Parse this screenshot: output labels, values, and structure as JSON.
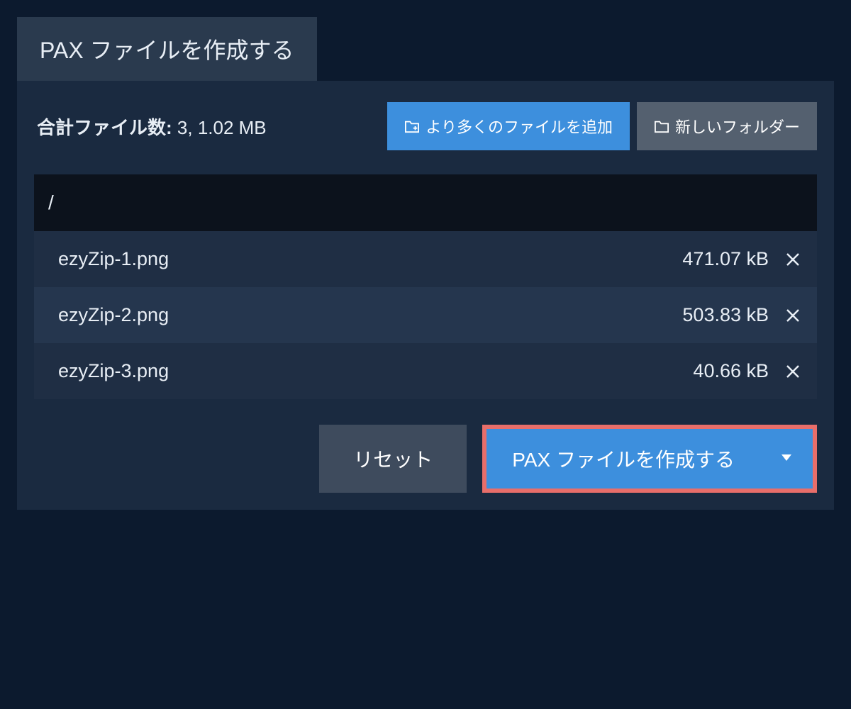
{
  "tab_title": "PAX ファイルを作成する",
  "summary": {
    "label": "合計ファイル数:",
    "value": "3, 1.02 MB"
  },
  "buttons": {
    "add_more": "より多くのファイルを追加",
    "new_folder": "新しいフォルダー",
    "reset": "リセット",
    "create_pax": "PAX ファイルを作成する"
  },
  "path": "/",
  "files": [
    {
      "name": "ezyZip-1.png",
      "size": "471.07 kB"
    },
    {
      "name": "ezyZip-2.png",
      "size": "503.83 kB"
    },
    {
      "name": "ezyZip-3.png",
      "size": "40.66 kB"
    }
  ]
}
